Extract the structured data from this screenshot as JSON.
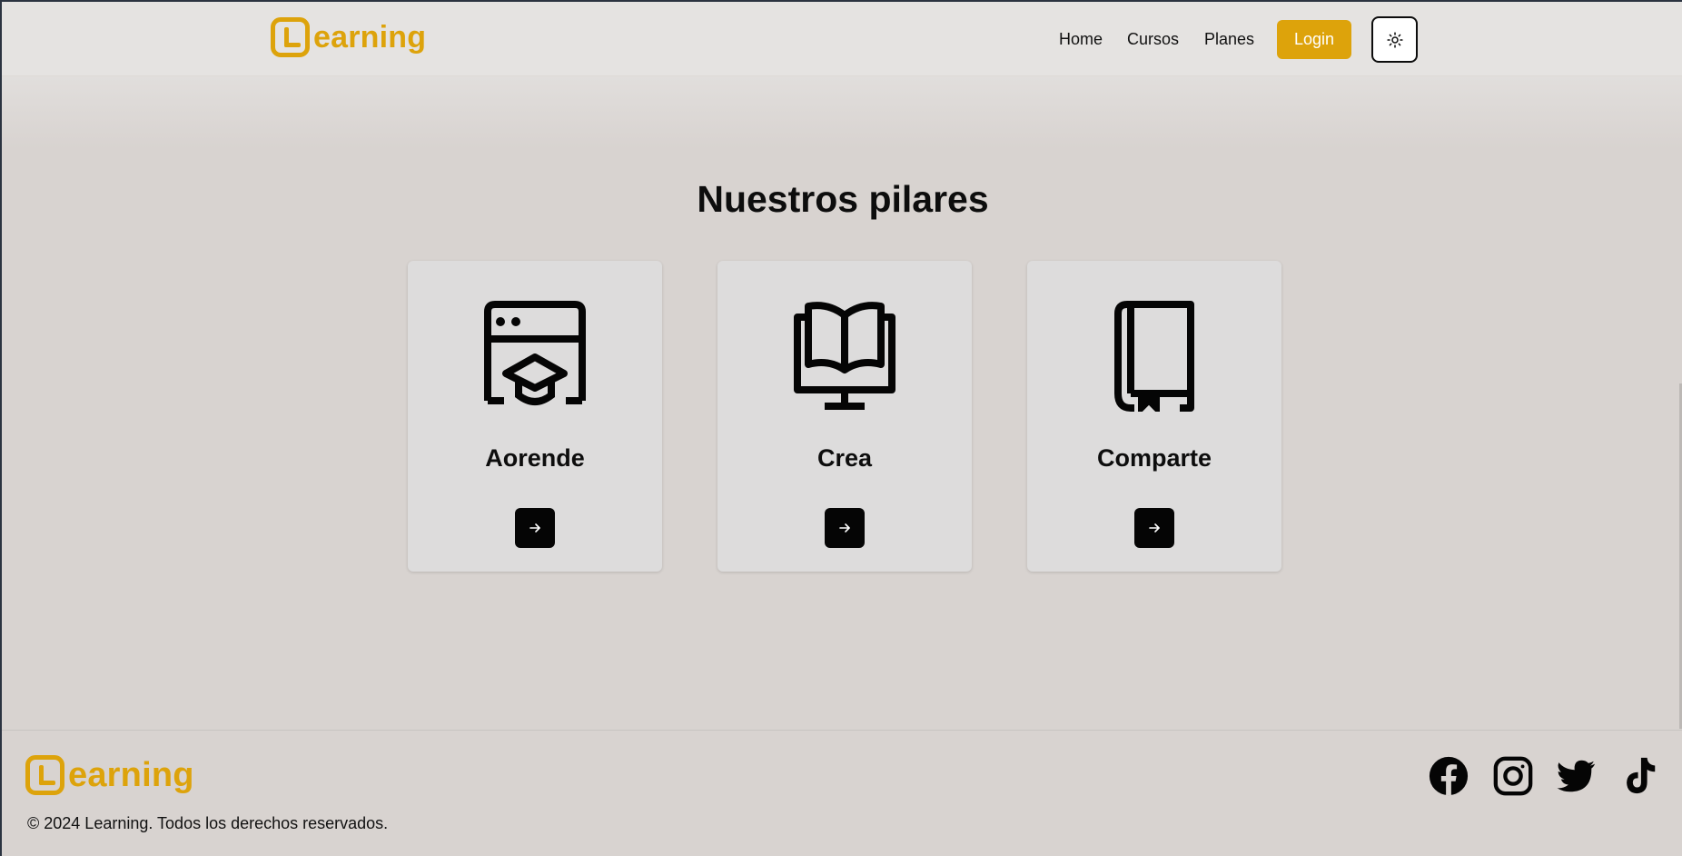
{
  "nav": {
    "brand_text": "earning",
    "links": [
      "Home",
      "Cursos",
      "Planes"
    ],
    "login_label": "Login",
    "theme_toggle_icon": "sun-icon"
  },
  "main": {
    "section_title": "Nuestros pilares",
    "cards": [
      {
        "title": "Aorende",
        "icon": "browser-graduation-cap-icon",
        "button_icon": "arrow-right-icon"
      },
      {
        "title": "Crea",
        "icon": "monitor-book-icon",
        "button_icon": "arrow-right-icon"
      },
      {
        "title": "Comparte",
        "icon": "book-bookmark-icon",
        "button_icon": "arrow-right-icon"
      }
    ]
  },
  "footer": {
    "brand_text": "earning",
    "copyright": "© 2024 Learning. Todos los derechos reservados.",
    "social_icons": [
      "facebook-icon",
      "instagram-icon",
      "twitter-icon",
      "tiktok-icon"
    ]
  },
  "colors": {
    "accent": "#dda30b",
    "background": "#d8d3d0",
    "card": "#dddcdc",
    "text": "#0d0d0d"
  }
}
